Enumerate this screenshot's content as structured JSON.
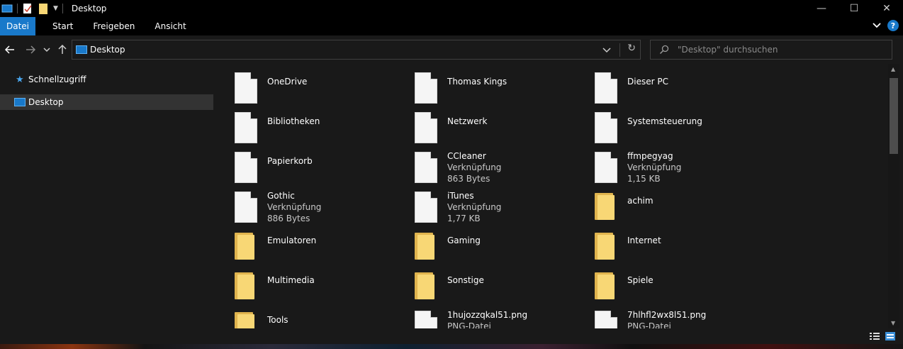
{
  "window": {
    "title": "Desktop",
    "controls": {
      "minimize": "—",
      "maximize": "☐",
      "close": "✕"
    }
  },
  "ribbon": {
    "tabs": [
      {
        "label": "Datei",
        "active": true
      },
      {
        "label": "Start"
      },
      {
        "label": "Freigeben"
      },
      {
        "label": "Ansicht"
      }
    ],
    "help": "?"
  },
  "address": {
    "path": "Desktop",
    "search_placeholder": "\"Desktop\" durchsuchen"
  },
  "nav": {
    "items": [
      {
        "label": "Schnellzugriff",
        "icon": "star-icon"
      },
      {
        "label": "Desktop",
        "icon": "desktop-icon",
        "selected": true
      }
    ]
  },
  "items": [
    {
      "name": "OneDrive",
      "icon": "document-icon"
    },
    {
      "name": "Thomas Kings",
      "icon": "document-icon"
    },
    {
      "name": "Dieser PC",
      "icon": "document-icon"
    },
    {
      "name": "Bibliotheken",
      "icon": "document-icon"
    },
    {
      "name": "Netzwerk",
      "icon": "document-icon"
    },
    {
      "name": "Systemsteuerung",
      "icon": "document-icon"
    },
    {
      "name": "Papierkorb",
      "icon": "document-icon"
    },
    {
      "name": "CCleaner",
      "type": "Verknüpfung",
      "size": "863 Bytes",
      "icon": "document-icon"
    },
    {
      "name": "ffmpegyag",
      "type": "Verknüpfung",
      "size": "1,15 KB",
      "icon": "document-icon"
    },
    {
      "name": "Gothic",
      "type": "Verknüpfung",
      "size": "886 Bytes",
      "icon": "document-icon"
    },
    {
      "name": "iTunes",
      "type": "Verknüpfung",
      "size": "1,77 KB",
      "icon": "document-icon"
    },
    {
      "name": "achim",
      "icon": "folder-icon"
    },
    {
      "name": "Emulatoren",
      "icon": "folder-icon"
    },
    {
      "name": "Gaming",
      "icon": "folder-icon"
    },
    {
      "name": "Internet",
      "icon": "folder-icon"
    },
    {
      "name": "Multimedia",
      "icon": "folder-icon"
    },
    {
      "name": "Sonstige",
      "icon": "folder-icon"
    },
    {
      "name": "Spiele",
      "icon": "folder-icon"
    },
    {
      "name": "Tools",
      "icon": "folder-icon"
    },
    {
      "name": "1hujozzqkal51.png",
      "type": "PNG-Datei",
      "icon": "document-icon"
    },
    {
      "name": "7hlhfl2wx8l51.png",
      "type": "PNG-Datei",
      "icon": "document-icon"
    }
  ],
  "colors": {
    "background": "#191919",
    "titlebar": "#000000",
    "accent": "#1979ca",
    "folder": "#f8d775",
    "selection": "#333333"
  }
}
